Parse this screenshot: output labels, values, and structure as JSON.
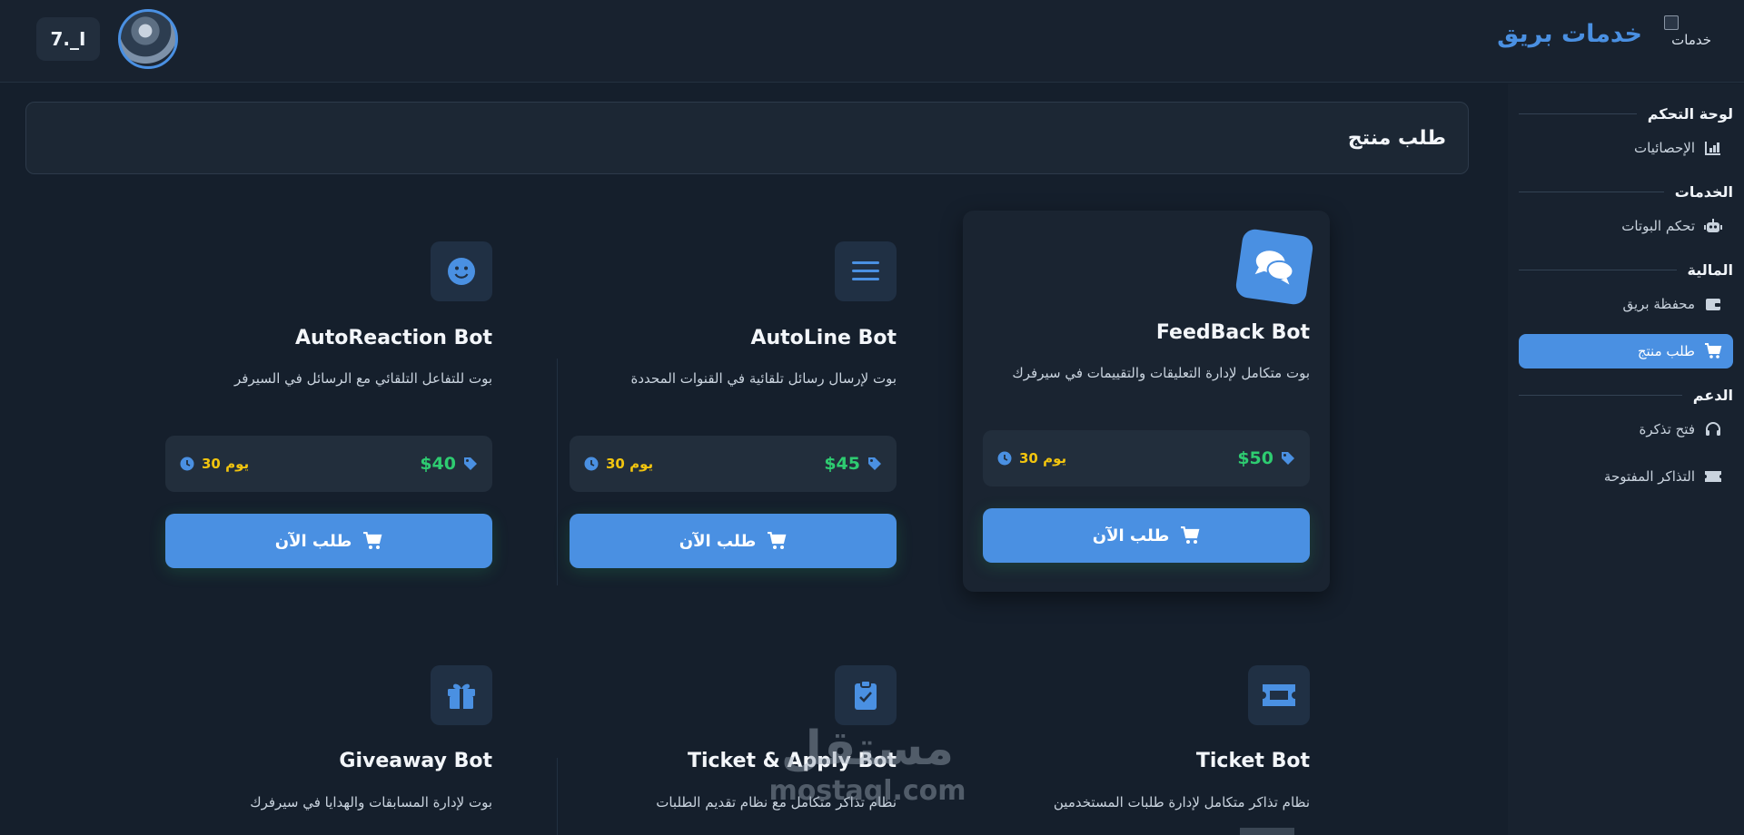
{
  "header": {
    "brand_alt": "خدمات",
    "brand_title": "خدمات بريق",
    "user_label": "7._I"
  },
  "sidebar": {
    "sections": [
      {
        "title": "لوحة التحكم",
        "items": [
          {
            "label": "الإحصائيات",
            "icon": "chart-icon"
          }
        ]
      },
      {
        "title": "الخدمات",
        "items": [
          {
            "label": "تحكم البوتات",
            "icon": "robot-icon"
          }
        ]
      },
      {
        "title": "المالية",
        "items": [
          {
            "label": "محفظة بريق",
            "icon": "wallet-icon"
          },
          {
            "label": "طلب منتج",
            "icon": "cart-icon",
            "active": true
          }
        ]
      },
      {
        "title": "الدعم",
        "items": [
          {
            "label": "فتح تذكرة",
            "icon": "headset-icon"
          },
          {
            "label": "التذاكر المفتوحة",
            "icon": "ticket-icon"
          }
        ]
      }
    ]
  },
  "page": {
    "title": "طلب منتج"
  },
  "products": [
    {
      "name": "FeedBack Bot",
      "desc": "بوت متكامل لإدارة التعليقات والتقييمات في سيرفرك",
      "price": "$50",
      "duration": "30 يوم",
      "button": "طلب الآن",
      "icon": "comments-icon",
      "featured": true
    },
    {
      "name": "AutoLine Bot",
      "desc": "بوت لإرسال رسائل تلقائية في القنوات المحددة",
      "price": "$45",
      "duration": "30 يوم",
      "button": "طلب الآن",
      "icon": "lines-icon"
    },
    {
      "name": "AutoReaction Bot",
      "desc": "بوت للتفاعل التلقائي مع الرسائل في السيرفر",
      "price": "$40",
      "duration": "30 يوم",
      "button": "طلب الآن",
      "icon": "smile-icon"
    },
    {
      "name": "Ticket Bot",
      "desc": "نظام تذاكر متكامل لإدارة طلبات المستخدمين",
      "icon": "ticket-icon"
    },
    {
      "name": "Ticket & Apply Bot",
      "desc": "نظام تذاكر متكامل مع نظام تقديم الطلبات",
      "icon": "clipboard-check-icon"
    },
    {
      "name": "Giveaway Bot",
      "desc": "بوت لإدارة المسابقات والهدايا في سيرفرك",
      "icon": "gift-icon"
    }
  ],
  "watermark": {
    "ar": "مستقل",
    "en": "mostaql.com"
  },
  "colors": {
    "accent": "#4a90e2",
    "price": "#2ecc71",
    "duration": "#f1c40f",
    "background": "#151f2c"
  }
}
